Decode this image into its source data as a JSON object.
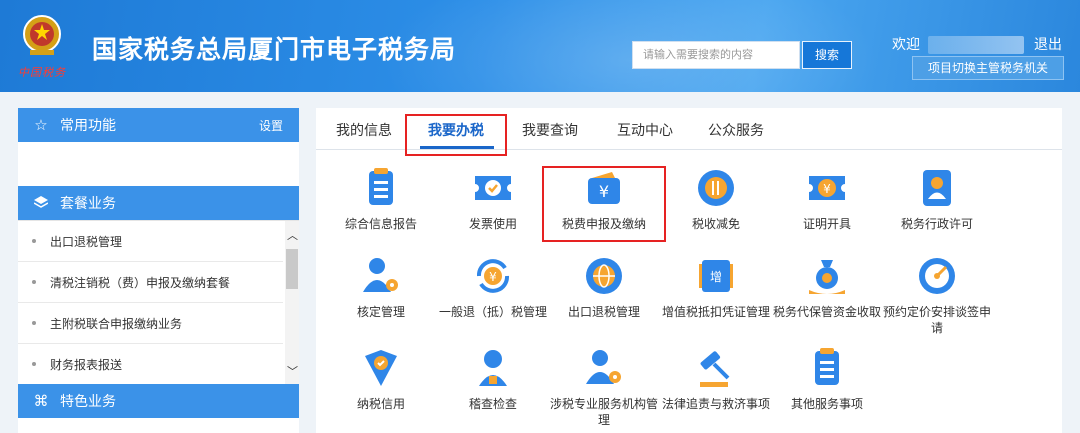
{
  "header": {
    "emblem_text": "中国税务",
    "site_title": "国家税务总局厦门市电子税务局",
    "search_placeholder": "请输入需要搜索的内容",
    "search_button": "搜索",
    "welcome": "欢迎",
    "logout": "退出",
    "switch_button": "项目切换主管税务机关"
  },
  "sidebar": {
    "common": {
      "label": "常用功能",
      "setting": "设置",
      "icon": "star-icon"
    },
    "package": {
      "label": "套餐业务",
      "icon": "layers-icon"
    },
    "items": [
      {
        "label": "出口退税管理"
      },
      {
        "label": "清税注销税（费）申报及缴纳套餐"
      },
      {
        "label": "主附税联合申报缴纳业务"
      },
      {
        "label": "财务报表报送"
      }
    ],
    "feature": {
      "label": "特色业务",
      "icon": "command-icon"
    }
  },
  "tabs": [
    {
      "label": "我的信息"
    },
    {
      "label": "我要办税",
      "active": true
    },
    {
      "label": "我要查询"
    },
    {
      "label": "互动中心"
    },
    {
      "label": "公众服务"
    }
  ],
  "services": [
    {
      "label": "综合信息报告",
      "icon": "report-icon"
    },
    {
      "label": "发票使用",
      "icon": "invoice-icon"
    },
    {
      "label": "税费申报及缴纳",
      "icon": "wallet-yen-icon",
      "highlighted": true
    },
    {
      "label": "税收减免",
      "icon": "tax-reduction-icon"
    },
    {
      "label": "证明开具",
      "icon": "certificate-icon"
    },
    {
      "label": "税务行政许可",
      "icon": "permit-icon"
    },
    {
      "label": "核定管理",
      "icon": "user-gear-icon"
    },
    {
      "label": "一般退（抵）税管理",
      "icon": "refund-cycle-icon"
    },
    {
      "label": "出口退税管理",
      "icon": "globe-icon"
    },
    {
      "label": "增值税抵扣凭证管理",
      "icon": "vat-voucher-icon"
    },
    {
      "label": "税务代保管资金收取",
      "icon": "money-bag-icon"
    },
    {
      "label": "预约定价安排谈签申请",
      "icon": "compass-icon"
    },
    {
      "label": "纳税信用",
      "icon": "credit-shield-icon"
    },
    {
      "label": "稽查检查",
      "icon": "inspector-icon"
    },
    {
      "label": "涉税专业服务机构管理",
      "icon": "agency-user-icon"
    },
    {
      "label": "法律追责与救济事项",
      "icon": "gavel-icon"
    },
    {
      "label": "其他服务事项",
      "icon": "clipboard-list-icon"
    }
  ],
  "colors": {
    "accent": "#1a66c9",
    "header_blue": "#2d8fe8",
    "highlight_red": "#e62222",
    "icon_blue": "#2f86e8",
    "icon_orange": "#f6a531"
  }
}
